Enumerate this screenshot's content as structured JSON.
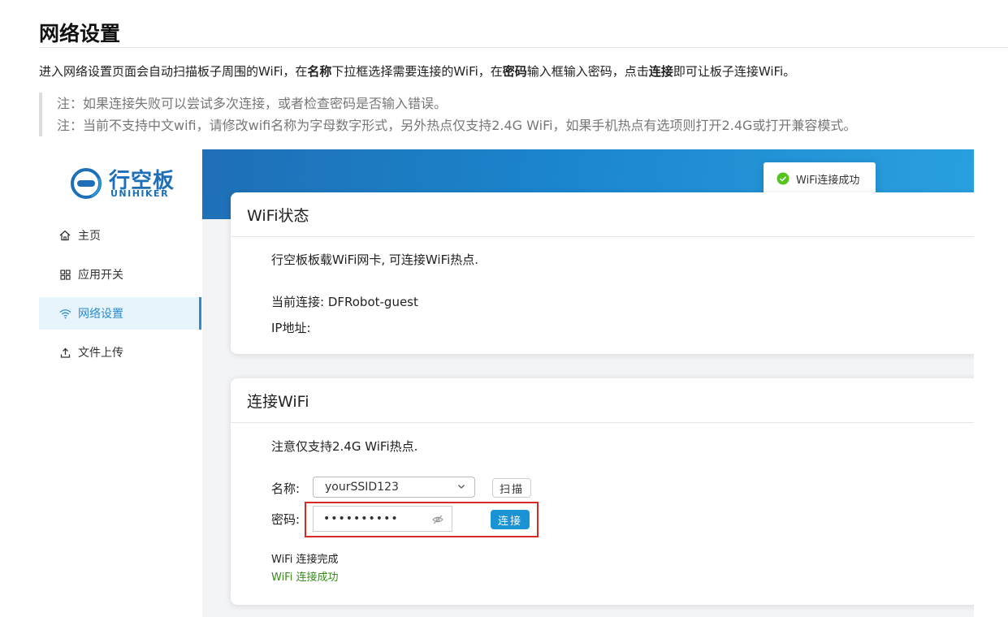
{
  "doc": {
    "title": "网络设置",
    "intro": {
      "part1": "进入网络设置页面会自动扫描板子周围的WiFi，在",
      "bold1": "名称",
      "part2": "下拉框选择需要连接的WiFi，在",
      "bold2": "密码",
      "part3": "输入框输入密码，点击",
      "bold3": "连接",
      "part4": "即可让板子连接WiFi。"
    },
    "notes": [
      "注：如果连接失败可以尝试多次连接，或者检查密码是否输入错误。",
      "注：当前不支持中文wifi，请修改wifi名称为字母数字形式，另外热点仅支持2.4G WiFi，如果手机热点有选项则打开2.4G或打开兼容模式。"
    ]
  },
  "app": {
    "logo": {
      "name": "行空板",
      "sub": "UNIHIKER"
    },
    "nav": [
      {
        "label": "主页",
        "icon": "home-icon",
        "active": false
      },
      {
        "label": "应用开关",
        "icon": "grid-icon",
        "active": false
      },
      {
        "label": "网络设置",
        "icon": "wifi-icon",
        "active": true
      },
      {
        "label": "文件上传",
        "icon": "upload-icon",
        "active": false
      }
    ],
    "toast": {
      "text": "WiFi连接成功",
      "icon": "check-circle-icon",
      "color": "#52c41a"
    },
    "status_card": {
      "title": "WiFi状态",
      "desc": "行空板板载WiFi网卡, 可连接WiFi热点.",
      "current_label": "当前连接: DFRobot-guest",
      "ip_label": "IP地址:"
    },
    "connect_card": {
      "title": "连接WiFi",
      "hint": "注意仅支持2.4G WiFi热点.",
      "name_label": "名称:",
      "ssid_value": "yourSSID123",
      "scan_button": "扫描",
      "password_label": "密码:",
      "password_value": "••••••••••",
      "connect_button": "连接",
      "status1": "WiFi 连接完成",
      "status2": "WiFi 连接成功",
      "status2_color": "#3a8a1f"
    },
    "colors": {
      "accent": "#2b8bd0",
      "banner": "#1b85cc",
      "highlight": "#d42a2a"
    }
  }
}
